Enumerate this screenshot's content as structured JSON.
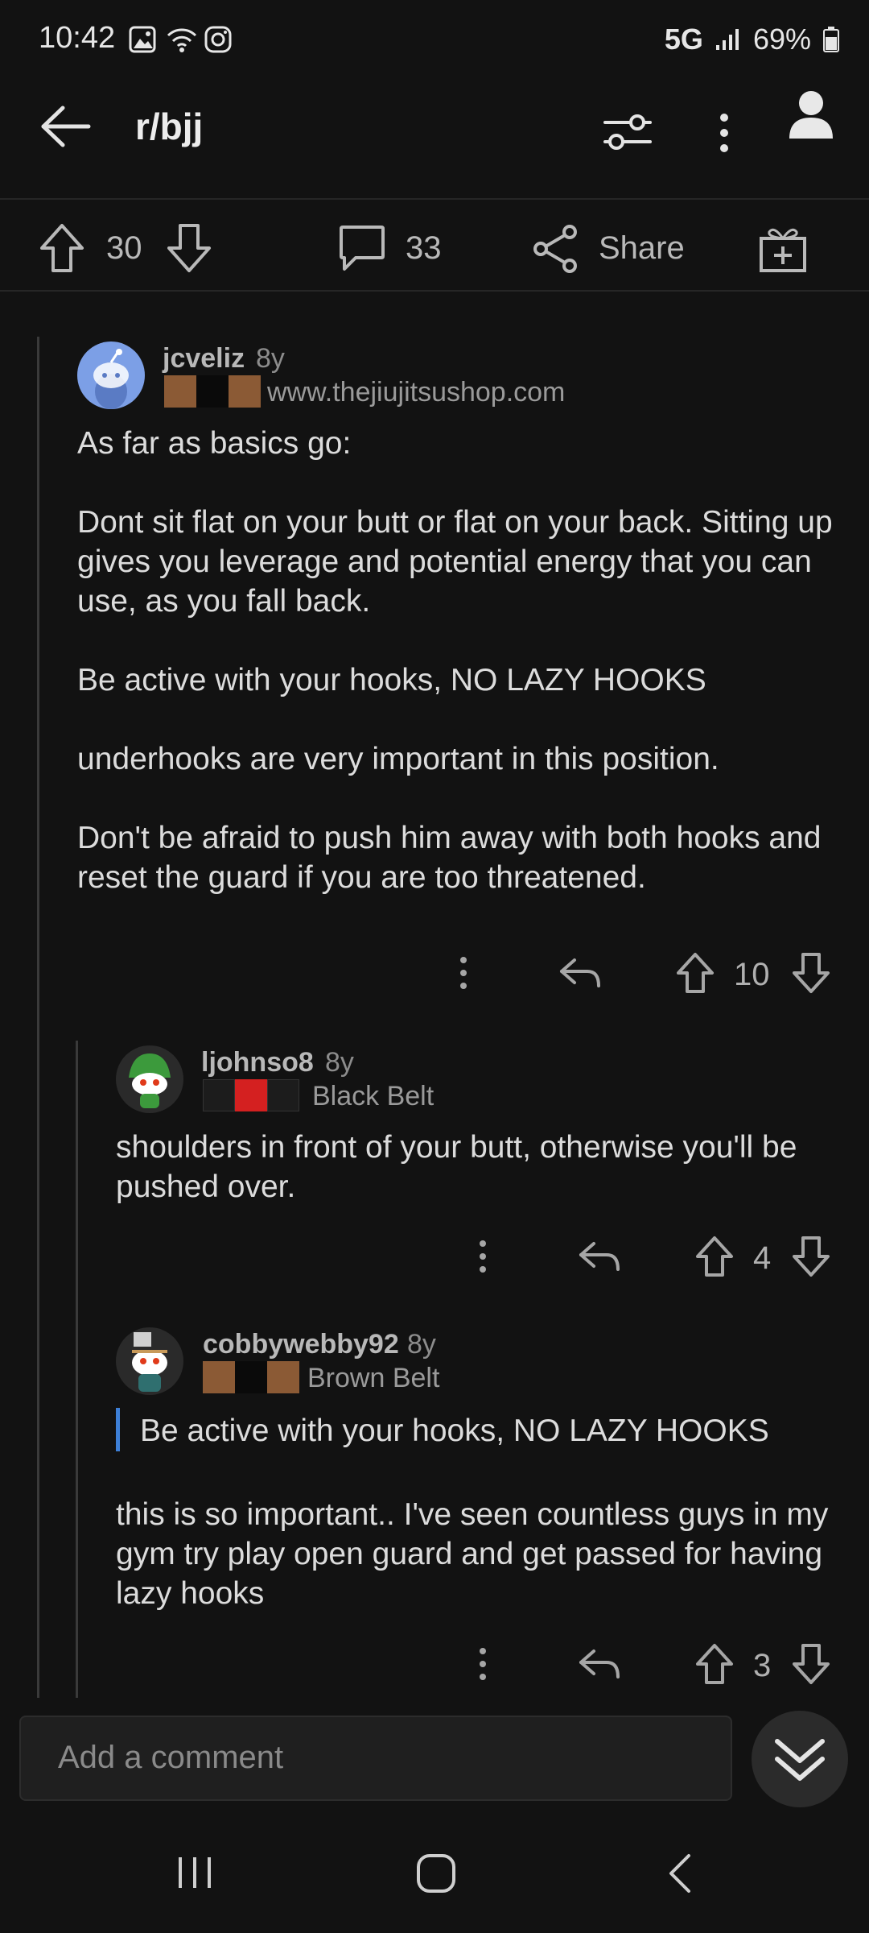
{
  "status": {
    "time": "10:42",
    "network": "5G",
    "battery": "69%"
  },
  "header": {
    "title": "r/bjj"
  },
  "post_actions": {
    "upvotes": "30",
    "comments": "33",
    "share_label": "Share"
  },
  "comments": [
    {
      "username": "jcveliz",
      "age": "8y",
      "flair": "www.thejiujitsushop.com",
      "body": "As far as basics go:\n\nDont sit flat on your butt or flat on your back. Sitting up gives you leverage and potential energy that you can use, as you fall back.\n\nBe active with your hooks, NO LAZY HOOKS\n\nunderhooks are very important in this position.\n\nDon't be afraid to push him away with both hooks and reset the guard if you are too threatened.",
      "score": "10"
    },
    {
      "username": "ljohnso8",
      "age": "8y",
      "flair": "Black Belt",
      "body": "shoulders in front of your butt, otherwise you'll be pushed over.",
      "score": "4"
    },
    {
      "username": "cobbywebby92",
      "age": "8y",
      "flair": "Brown Belt",
      "quote": "Be active with your hooks, NO LAZY HOOKS",
      "body": "this is so important.. I've seen countless guys in my gym try play open guard and get passed for having lazy hooks",
      "score": "3"
    }
  ],
  "composer": {
    "placeholder": "Add a comment"
  },
  "colors": {
    "background": "#121212",
    "quote_accent": "#3d7fd6",
    "belt_brown": "#8b5a35",
    "belt_black_stripe": "#d42020"
  }
}
